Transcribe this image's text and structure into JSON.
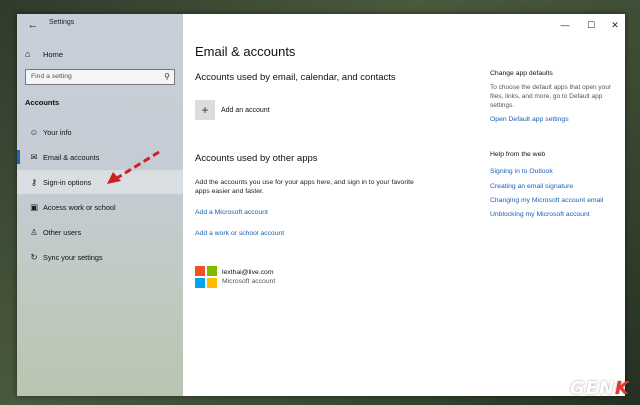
{
  "window": {
    "title": "Settings",
    "controls": {
      "minimize": "—",
      "maximize": "☐",
      "close": "✕"
    }
  },
  "sidebar": {
    "home_label": "Home",
    "search_placeholder": "Find a setting",
    "section": "Accounts",
    "items": [
      {
        "label": "Your info",
        "icon": "person-card-icon"
      },
      {
        "label": "Email & accounts",
        "icon": "mail-icon"
      },
      {
        "label": "Sign-in options",
        "icon": "key-icon"
      },
      {
        "label": "Access work or school",
        "icon": "briefcase-icon"
      },
      {
        "label": "Other users",
        "icon": "person-add-icon"
      },
      {
        "label": "Sync your settings",
        "icon": "sync-icon"
      }
    ],
    "annotation_color": "#cc2222"
  },
  "main": {
    "title": "Email & accounts",
    "section1_heading": "Accounts used by email, calendar, and contacts",
    "add_account_label": "Add an account",
    "section2_heading": "Accounts used by other apps",
    "section2_description": "Add the accounts you use for your apps here, and sign in to your favorite apps easier and faster.",
    "add_microsoft_account": "Add a Microsoft account",
    "add_work_school_account": "Add a work or school account",
    "account": {
      "email": "lexthai@live.com",
      "type": "Microsoft account"
    }
  },
  "related": {
    "change_defaults_heading": "Change app defaults",
    "change_defaults_desc": "To choose the default apps that open your files, links, and more, go to Default app settings.",
    "open_default_link": "Open Default app settings",
    "help_heading": "Help from the web",
    "help_links": [
      "Signing in to Outlook",
      "Creating an email signature",
      "Changing my Microsoft account email",
      "Unblocking my Microsoft account"
    ]
  },
  "watermark": {
    "prefix": "GEN",
    "suffix": "K"
  },
  "colors": {
    "accent": "#1a66c7",
    "link": "#1a5fb4"
  }
}
